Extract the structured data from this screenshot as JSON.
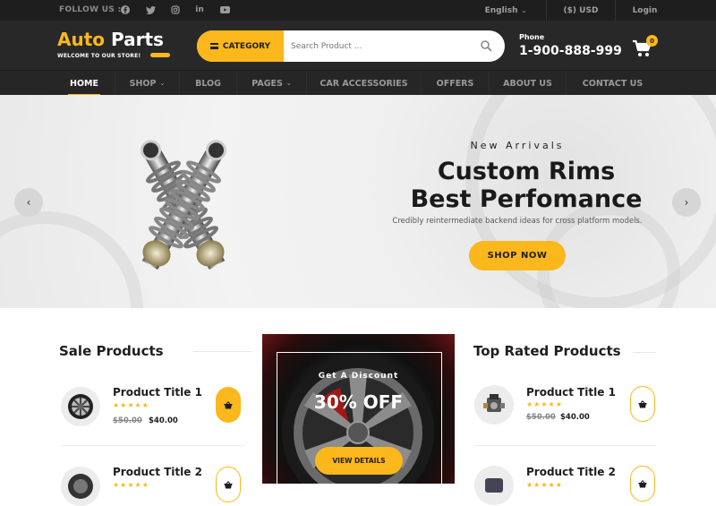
{
  "topbar": {
    "follow_label": "FOLLOW US :",
    "social_icons": [
      "facebook-icon",
      "twitter-icon",
      "instagram-icon",
      "linkedin-icon",
      "youtube-icon"
    ],
    "language": "English",
    "currency": "($) USD",
    "login": "Login"
  },
  "header": {
    "logo_part1": "Auto",
    "logo_part2": "Parts",
    "tagline": "WELCOME TO OUR STORE!",
    "category_label": "CATEGORY",
    "search_placeholder": "Search Product ...",
    "phone_label": "Phone",
    "phone_number": "1-900-888-999",
    "cart_count": "0"
  },
  "nav": {
    "items": [
      {
        "label": "HOME",
        "active": true
      },
      {
        "label": "SHOP",
        "dropdown": true
      },
      {
        "label": "BLOG"
      },
      {
        "label": "PAGES",
        "dropdown": true
      },
      {
        "label": "CAR ACCESSORIES"
      },
      {
        "label": "OFFERS"
      },
      {
        "label": "ABOUT US"
      },
      {
        "label": "CONTACT US"
      }
    ]
  },
  "hero": {
    "subtitle": "New Arrivals",
    "title_line1": "Custom Rims",
    "title_line2": "Best Perfomance",
    "description": "Credibly reintermediate backend ideas for cross platform models.",
    "cta": "SHOP NOW",
    "prev_icon": "‹",
    "next_icon": "›"
  },
  "sale_products": {
    "title": "Sale Products",
    "items": [
      {
        "title": "Product Title 1",
        "rating": 5,
        "old_price": "$50.00",
        "price": "$40.00"
      },
      {
        "title": "Product Title 2",
        "rating": 5
      }
    ]
  },
  "promo": {
    "subtitle": "Get A Discount",
    "headline": "30% OFF",
    "cta": "VIEW DETAILS"
  },
  "top_rated": {
    "title": "Top Rated Products",
    "items": [
      {
        "title": "Product Title 1",
        "rating": 5,
        "old_price": "$50.00",
        "price": "$40.00"
      },
      {
        "title": "Product Title 2",
        "rating": 5
      }
    ]
  },
  "colors": {
    "accent": "#fbb71b",
    "dark": "#282828",
    "topbar": "#1e1e1e"
  },
  "stars": "★★★★★"
}
